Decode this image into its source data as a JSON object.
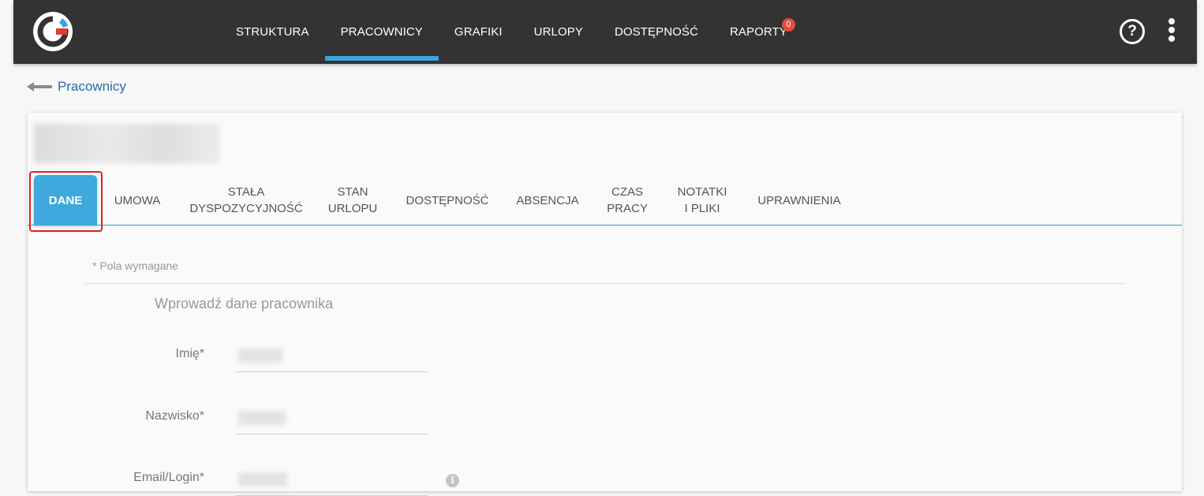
{
  "header": {
    "nav": [
      {
        "label": "STRUKTURA"
      },
      {
        "label": "PRACOWNICY"
      },
      {
        "label": "GRAFIKI"
      },
      {
        "label": "URLOPY"
      },
      {
        "label": "DOSTĘPNOŚĆ"
      },
      {
        "label": "RAPORTY",
        "badge": "0"
      }
    ],
    "active_nav": "PRACOWNICY",
    "help_icon": "question-circle-icon",
    "menu_icon": "vertical-dots-icon",
    "accent_color": "#3ba4d9",
    "badge_color": "#e74c3c"
  },
  "breadcrumb": {
    "label": "Pracownicy",
    "icon": "back-arrow-icon"
  },
  "card": {
    "tabs": [
      {
        "label": "DANE"
      },
      {
        "label": "UMOWA"
      },
      {
        "label": "STAŁA\nDYSPOZYCYJNOŚĆ"
      },
      {
        "label": "STAN\nURLOPU"
      },
      {
        "label": "DOSTĘPNOŚĆ"
      },
      {
        "label": "ABSENCJA"
      },
      {
        "label": "CZAS\nPRACY"
      },
      {
        "label": "NOTATKI\nI PLIKI"
      },
      {
        "label": "UPRAWNIENIA"
      }
    ],
    "active_tab": "DANE",
    "required_note": "* Pola wymagane",
    "section_title": "Wprowadź dane pracownika",
    "fields": [
      {
        "label": "Imię*"
      },
      {
        "label": "Nazwisko*"
      },
      {
        "label": "Email/Login*"
      }
    ],
    "info_icon": "info-circle-icon"
  }
}
